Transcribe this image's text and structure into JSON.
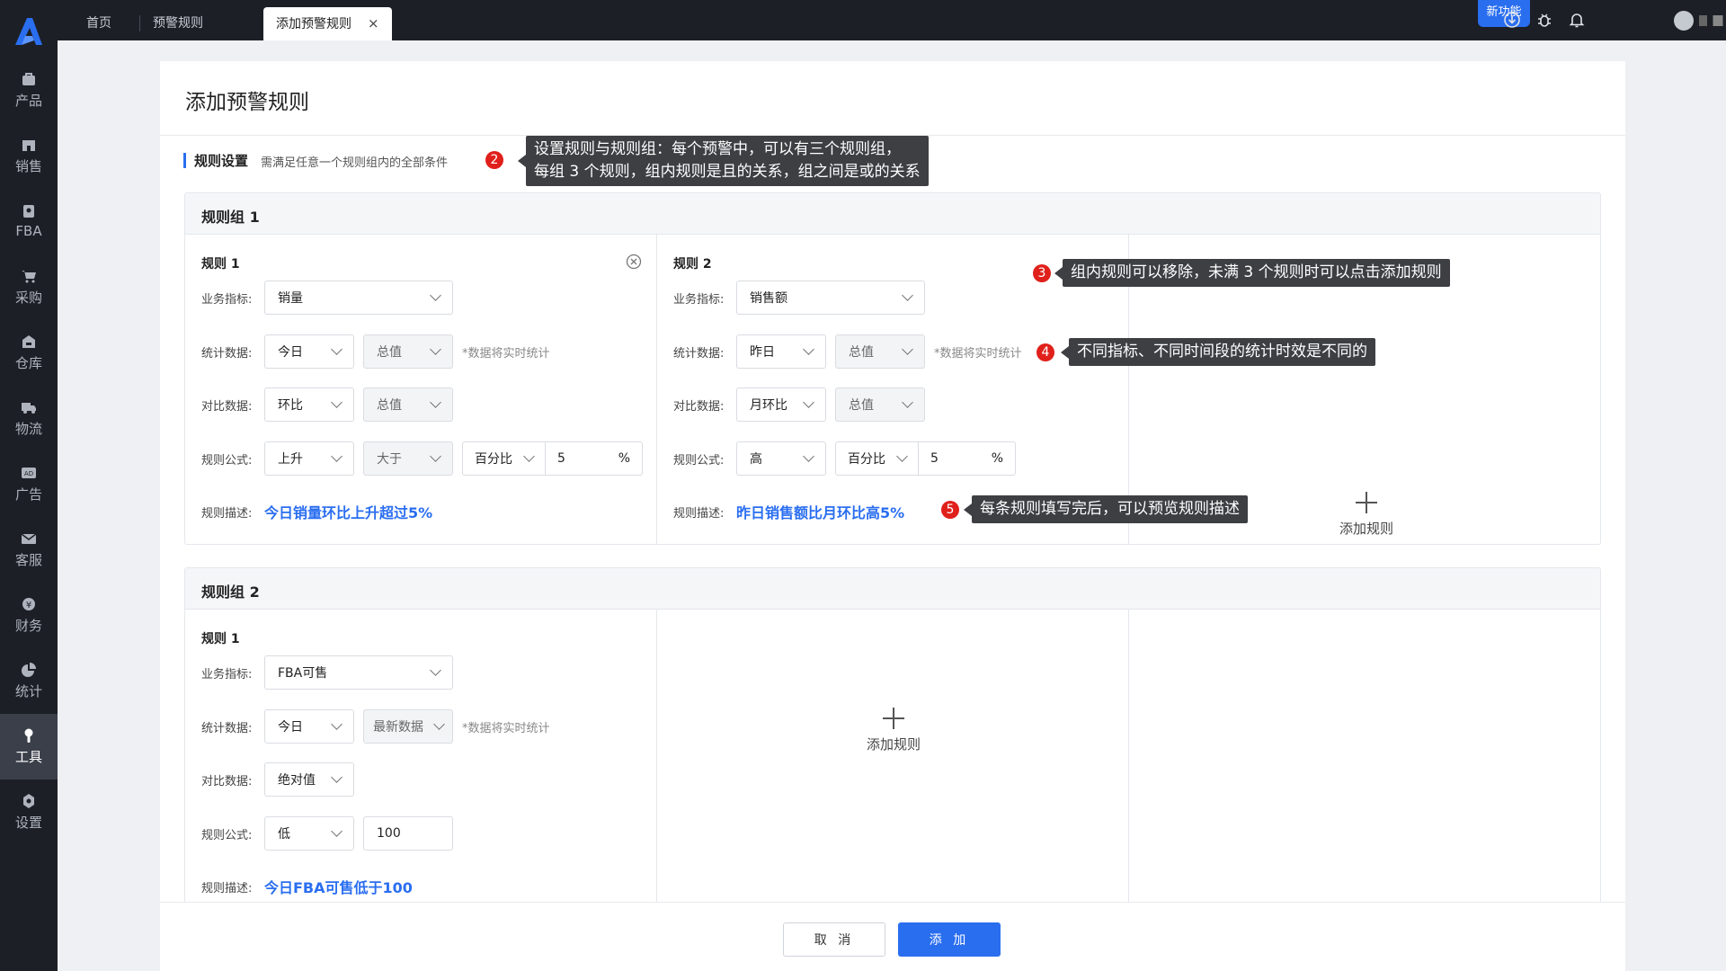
{
  "tabs": [
    {
      "label": "首页"
    },
    {
      "label": "预警规则"
    },
    {
      "label": "添加预警规则",
      "close": "×"
    }
  ],
  "new_feature": "新功能",
  "sidebar": [
    "产品",
    "销售",
    "FBA",
    "采购",
    "仓库",
    "物流",
    "广告",
    "客服",
    "财务",
    "统计",
    "工具",
    "设置"
  ],
  "active_nav": "工具",
  "page": {
    "title": "添加预警规则",
    "section_title": "规则设置",
    "section_desc": "需满足任意一个规则组内的全部条件"
  },
  "labels": {
    "metric": "业务指标:",
    "stat": "统计数据:",
    "compare": "对比数据:",
    "formula": "规则公式:",
    "desc": "规则描述:",
    "add_rule": "添加规则",
    "note": "*数据将实时统计",
    "percent": "%"
  },
  "groups": [
    {
      "title": "规则组 1",
      "rules": [
        {
          "title": "规则 1",
          "metric": "销量",
          "stat_period": "今日",
          "stat_type": "总值",
          "compare_period": "环比",
          "compare_type": "总值",
          "formula_dir": "上升",
          "formula_op": "大于",
          "formula_unit": "百分比",
          "formula_value": "5",
          "desc": "今日销量环比上升超过5%"
        },
        {
          "title": "规则 2",
          "metric": "销售额",
          "stat_period": "昨日",
          "stat_type": "总值",
          "compare_period": "月环比",
          "compare_type": "总值",
          "formula_dir": "高",
          "formula_unit": "百分比",
          "formula_value": "5",
          "desc": "昨日销售额比月环比高5%"
        }
      ]
    },
    {
      "title": "规则组 2",
      "rules": [
        {
          "title": "规则 1",
          "metric": "FBA可售",
          "stat_period": "今日",
          "stat_type": "最新数据",
          "compare_period": "绝对值",
          "formula_dir": "低",
          "formula_value": "100",
          "desc": "今日FBA可售低于100"
        }
      ]
    }
  ],
  "callouts": {
    "c2": {
      "num": "2",
      "text1": "设置规则与规则组：每个预警中，可以有三个规则组，",
      "text2": "每组 3 个规则，组内规则是且的关系，组之间是或的关系"
    },
    "c3": {
      "num": "3",
      "text": "组内规则可以移除，未满 3 个规则时可以点击添加规则"
    },
    "c4": {
      "num": "4",
      "text": "不同指标、不同时间段的统计时效是不同的"
    },
    "c5": {
      "num": "5",
      "text": "每条规则填写完后，可以预览规则描述"
    }
  },
  "footer": {
    "cancel": "取 消",
    "add": "添 加"
  },
  "colors": {
    "accent": "#2a6ef0",
    "sidebar_bg": "#1c1f26",
    "badge": "#e0201b"
  }
}
